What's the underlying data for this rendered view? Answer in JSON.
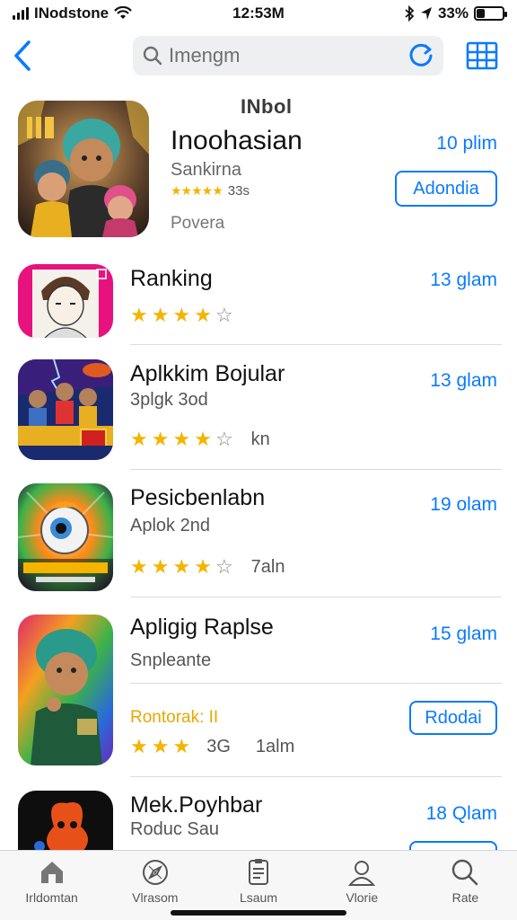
{
  "status_bar": {
    "carrier": "INodstone",
    "time": "12:53M",
    "battery": "33%",
    "battery_level": 0.33
  },
  "nav": {
    "search_value": "Imengm"
  },
  "featured": {
    "badge": "INbol",
    "title": "Inoohasian",
    "subtitle": "Sankirna",
    "stars": "★★★★★",
    "rating_count": "33s",
    "tag": "Povera",
    "time": "10 plim",
    "button": "Adondia"
  },
  "apps": [
    {
      "title": "Ranking",
      "time": "13 glam",
      "rating": 4
    },
    {
      "title": "Aplkkim Bojular",
      "subtitle": "3plgk 3od",
      "extra": "kn",
      "time": "13 glam",
      "rating": 4
    },
    {
      "title": "Pesicbenlabn",
      "subtitle": "Aplok 2nd",
      "extra": "7aln",
      "time": "19 olam",
      "rating": 4
    },
    {
      "title": "Apligig Raplse",
      "subtitle": "Snpleante",
      "promo": "Rontorak: II",
      "count": "3G",
      "extra": "1alm",
      "time": "15 glam",
      "button": "Rdodai",
      "rating": 3
    },
    {
      "title": "Mek.Poyhbar",
      "subtitle": "Roduc Sau",
      "time": "18 Qlam"
    }
  ],
  "tabs": [
    {
      "label": "Irldomtan",
      "icon": "home-icon"
    },
    {
      "label": "Vlrasom",
      "icon": "compass-icon"
    },
    {
      "label": "Lsaum",
      "icon": "list-icon"
    },
    {
      "label": "Vlorie",
      "icon": "person-icon"
    },
    {
      "label": "Rate",
      "icon": "search-icon"
    }
  ],
  "colors": {
    "accent": "#0a7aff",
    "star": "#f4b400",
    "promo": "#e6a800"
  }
}
